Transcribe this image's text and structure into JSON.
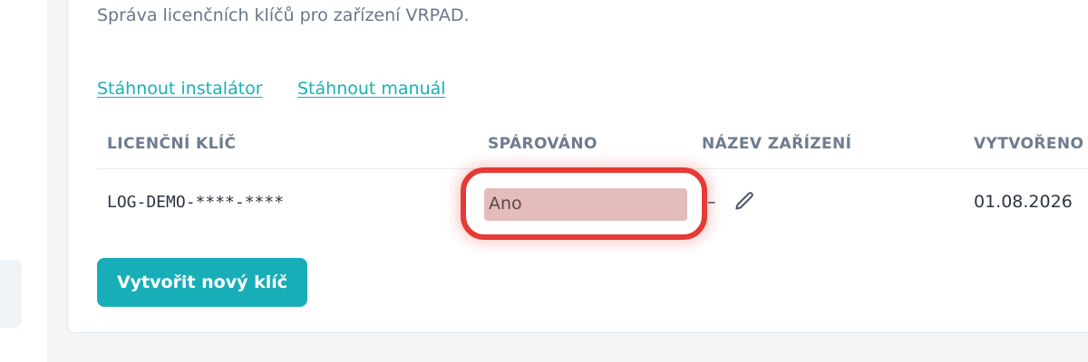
{
  "page": {
    "description": "Správa licenčních klíčů pro zařízení VRPAD."
  },
  "links": {
    "installer": "Stáhnout instalátor",
    "manual": "Stáhnout manuál"
  },
  "table": {
    "columns": [
      "LICENČNÍ KLÍČ",
      "SPÁROVÁNO",
      "NÁZEV ZAŘÍZENÍ",
      "VYTVOŘENO"
    ],
    "rows": [
      {
        "license_key": "LOG-DEMO-****-****",
        "paired": "Ano",
        "device_name": "–",
        "created": "01.08.2026"
      }
    ]
  },
  "actions": {
    "create_key": "Vytvořit nový klíč"
  },
  "icons": {
    "edit": "pencil-icon"
  },
  "colors": {
    "accent": "#17aeb8",
    "highlight": "#e53a35"
  }
}
